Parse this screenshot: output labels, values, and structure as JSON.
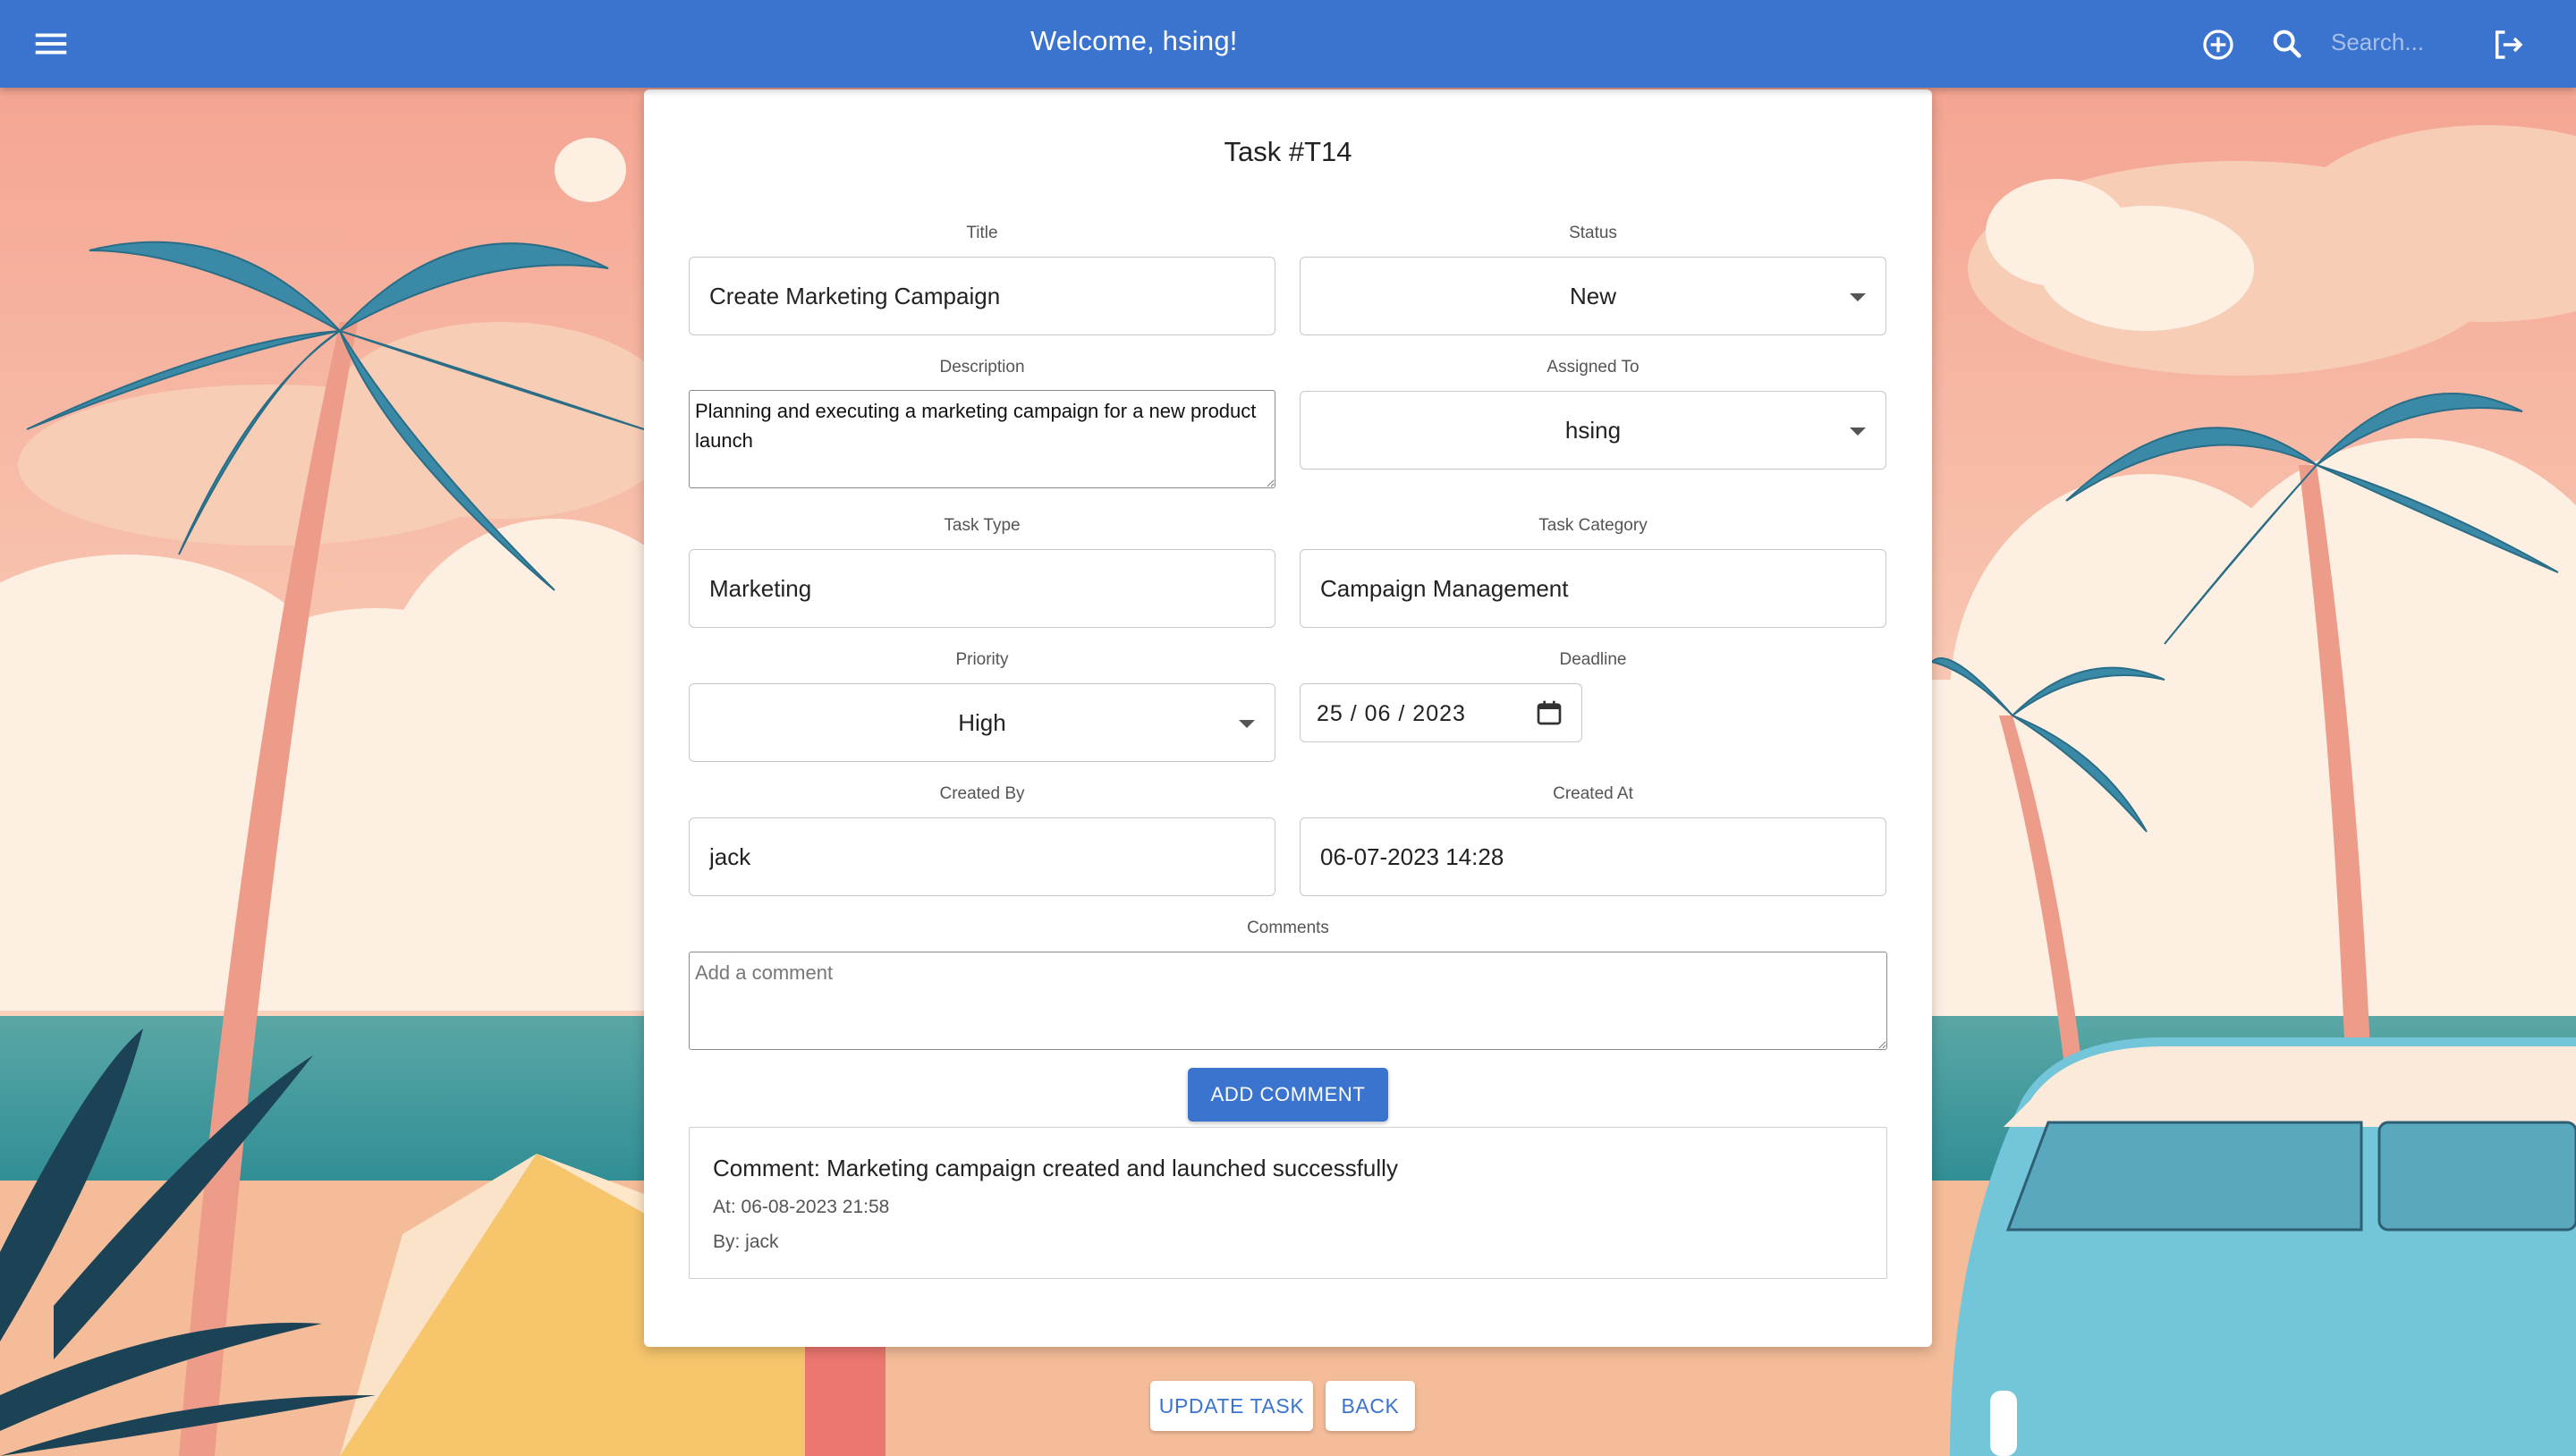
{
  "appbar": {
    "title": "Welcome, hsing!",
    "search_placeholder": "Search...",
    "icons": [
      "menu-icon",
      "add-circle-icon",
      "search-icon",
      "logout-icon"
    ],
    "color": "#3a74cf"
  },
  "task": {
    "heading": "Task #T14",
    "fields": {
      "title": {
        "label": "Title",
        "value": "Create Marketing Campaign"
      },
      "status": {
        "label": "Status",
        "value": "New"
      },
      "description": {
        "label": "Description",
        "value": "Planning and executing a marketing campaign for a new product launch"
      },
      "assigned_to": {
        "label": "Assigned To",
        "value": "hsing"
      },
      "task_type": {
        "label": "Task Type",
        "value": "Marketing"
      },
      "task_category": {
        "label": "Task Category",
        "value": "Campaign Management"
      },
      "priority": {
        "label": "Priority",
        "value": "High"
      },
      "deadline": {
        "label": "Deadline",
        "value": "25 / 06 / 2023"
      },
      "created_by": {
        "label": "Created By",
        "value": "jack"
      },
      "created_at": {
        "label": "Created At",
        "value": "06-07-2023 14:28"
      }
    },
    "comments": {
      "label": "Comments",
      "placeholder": "Add a comment",
      "add_button": "ADD COMMENT",
      "items": [
        {
          "text": "Comment: Marketing campaign created and launched successfully",
          "at": "At: 06-08-2023 21:58",
          "by": "By: jack"
        }
      ]
    }
  },
  "actions": {
    "update": "UPDATE TASK",
    "back": "BACK"
  }
}
